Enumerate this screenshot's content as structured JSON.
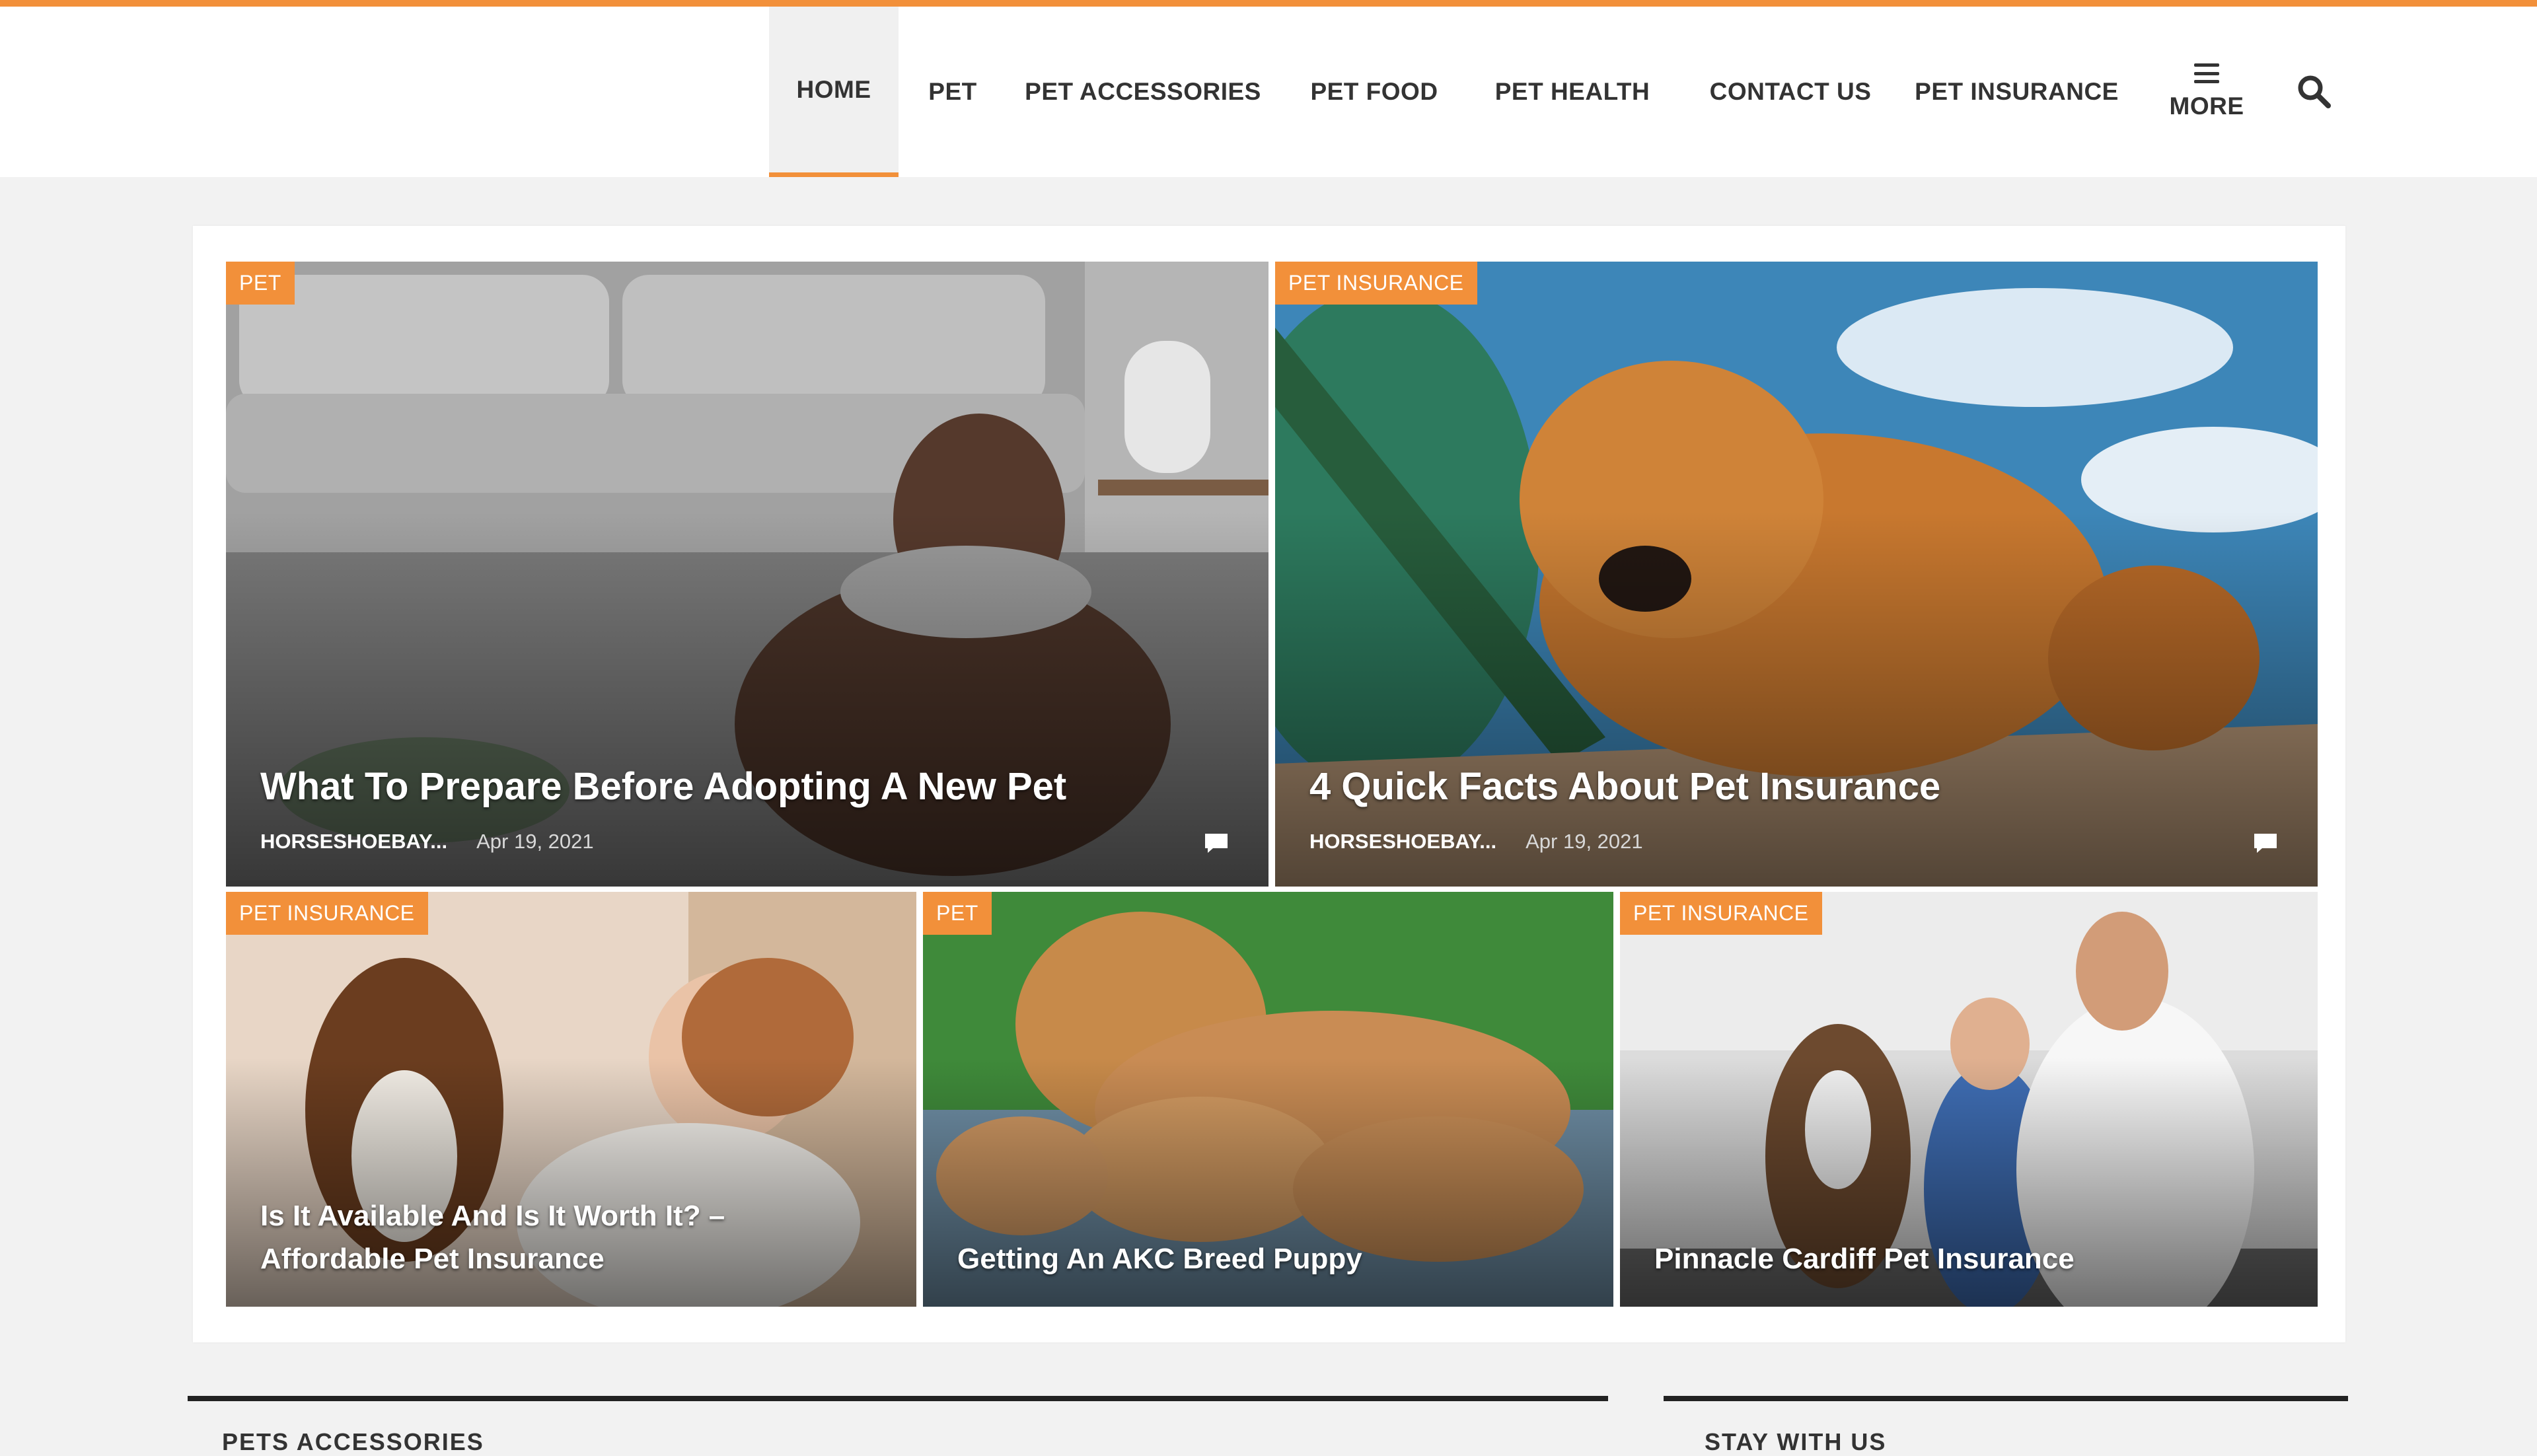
{
  "nav": {
    "items": [
      {
        "label": "HOME",
        "active": true
      },
      {
        "label": "PET"
      },
      {
        "label": "PET ACCESSORIES"
      },
      {
        "label": "PET FOOD"
      },
      {
        "label": "PET HEALTH"
      },
      {
        "label": "CONTACT US"
      },
      {
        "label": "PET INSURANCE"
      }
    ],
    "more_label": "MORE",
    "more_icon": "hamburger-icon",
    "search_icon": "search-icon",
    "accent_color": "#f2903a"
  },
  "featured": {
    "posts": [
      {
        "category": "PET",
        "title": "What To Prepare Before Adopting A New Pet",
        "author": "HORSESHOEBAY...",
        "date": "Apr 19, 2021",
        "comment_icon": "comment-icon"
      },
      {
        "category": "PET INSURANCE",
        "title": "4 Quick Facts About Pet Insurance",
        "author": "HORSESHOEBAY...",
        "date": "Apr 19, 2021",
        "comment_icon": "comment-icon"
      },
      {
        "category": "PET INSURANCE",
        "title": "Is It Available And Is It Worth It? – Affordable Pet Insurance"
      },
      {
        "category": "PET",
        "title": "Getting An AKC Breed Puppy"
      },
      {
        "category": "PET INSURANCE",
        "title": "Pinnacle Cardiff Pet Insurance"
      }
    ]
  },
  "sections": {
    "left_title": "PETS ACCESSORIES",
    "right_title": "STAY WITH US"
  }
}
